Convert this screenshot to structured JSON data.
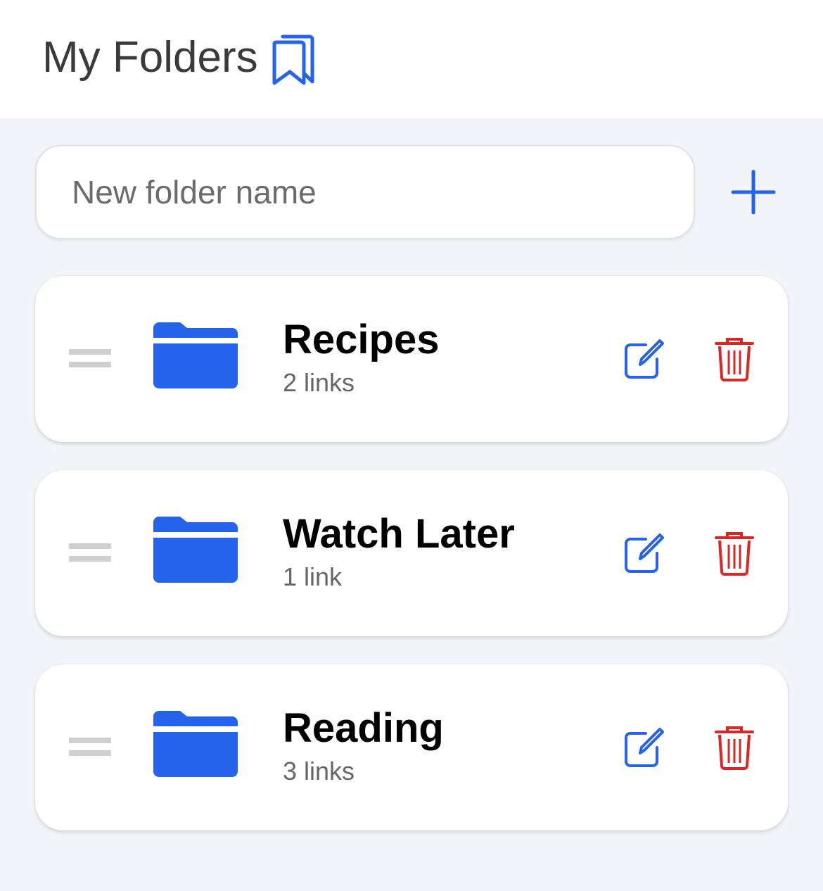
{
  "header": {
    "title": "My Folders",
    "icon": "bookmarks-icon"
  },
  "new_folder": {
    "placeholder": "New folder name",
    "value": "",
    "add_icon": "plus-icon"
  },
  "folders": [
    {
      "name": "Recipes",
      "count": "2 links"
    },
    {
      "name": "Watch Later",
      "count": "1 link"
    },
    {
      "name": "Reading",
      "count": "3 links"
    }
  ],
  "colors": {
    "accent": "#2563eb",
    "danger": "#dc2626",
    "background": "#f2f4f7",
    "drag_handle": "#cfcfcf"
  }
}
